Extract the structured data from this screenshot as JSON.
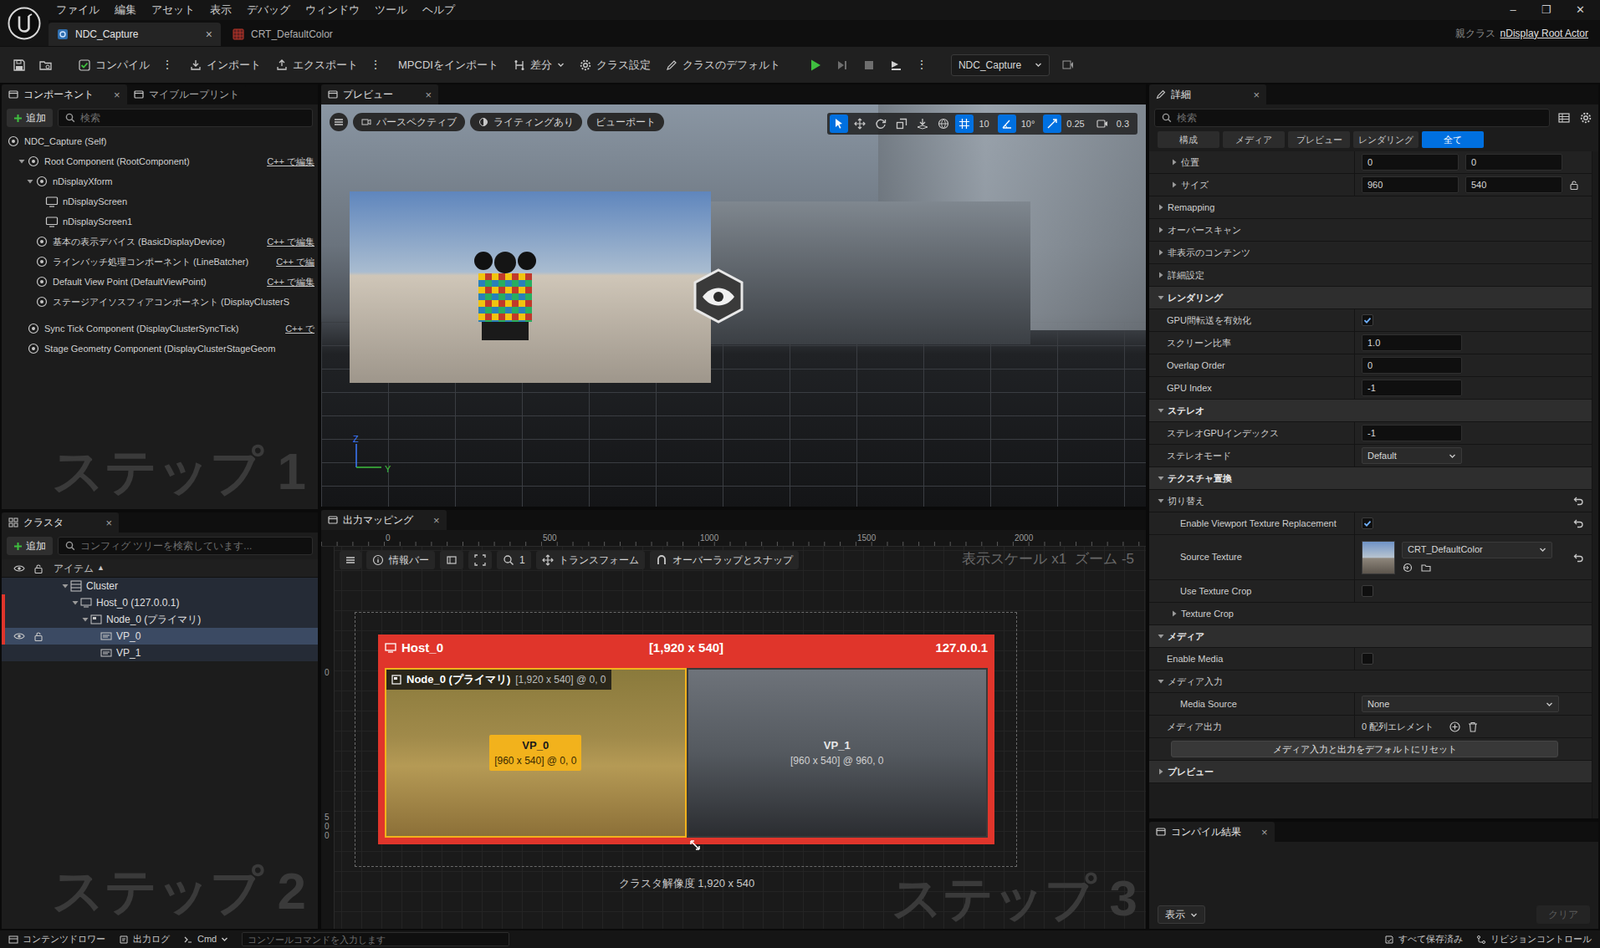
{
  "menu": {
    "items": [
      "ファイル",
      "編集",
      "アセット",
      "表示",
      "デバッグ",
      "ウィンドウ",
      "ツール",
      "ヘルプ"
    ],
    "window_controls": [
      "–",
      "❐",
      "✕"
    ]
  },
  "document_tabs": [
    {
      "label": "NDC_Capture",
      "selected": true,
      "close": "×"
    },
    {
      "label": "CRT_DefaultColor",
      "selected": false
    }
  ],
  "parent_class": {
    "label": "親クラス",
    "value": "nDisplay Root Actor"
  },
  "toolbar": {
    "items": [
      {
        "label": "コンパイル",
        "more": "⋮"
      },
      {
        "label": "インポート"
      },
      {
        "label": "エクスポート",
        "more": "⋮"
      },
      {
        "label": "MPCDIをインポート"
      },
      {
        "label": "差分",
        "dropdown": true
      },
      {
        "label": "クラス設定"
      },
      {
        "label": "クラスのデフォルト"
      }
    ],
    "play_more": "⋮",
    "debug_object": "NDC_Capture"
  },
  "components": {
    "tabs": [
      {
        "label": "コンポーネント",
        "selected": true,
        "close": "×"
      },
      {
        "label": "マイブループリント",
        "selected": false
      }
    ],
    "add": "追加",
    "search_placeholder": "検索",
    "tree": [
      {
        "label": "NDC_Capture (Self)",
        "depth": 0
      },
      {
        "label": "Root Component (RootComponent)",
        "depth": 1,
        "expanded": true,
        "edit": "C++ で編集"
      },
      {
        "label": "nDisplayXform",
        "depth": 2,
        "expanded": true
      },
      {
        "label": "nDisplayScreen",
        "depth": 3
      },
      {
        "label": "nDisplayScreen1",
        "depth": 3
      },
      {
        "label": "基本の表示デバイス (BasicDisplayDevice)",
        "depth": 2,
        "edit": "C++ で編集"
      },
      {
        "label": "ラインバッチ処理コンポーネント (LineBatcher)",
        "depth": 2,
        "edit": "C++ で編"
      },
      {
        "label": "Default View Point (DefaultViewPoint)",
        "depth": 2,
        "edit": "C++ で編集"
      },
      {
        "label": "ステージアイソスフィアコンポーネント (DisplayClusterS",
        "depth": 2
      },
      {
        "label": "Sync Tick Component (DisplayClusterSyncTick)",
        "depth": 1,
        "edit": "C++ で"
      },
      {
        "label": "Stage Geometry Component (DisplayClusterStageGeom",
        "depth": 1
      }
    ],
    "watermark": "ステップ 1"
  },
  "cluster": {
    "tab": "クラスタ",
    "close": "×",
    "add": "追加",
    "search_placeholder": "コンフィグ ツリーを検索しています...",
    "column": "アイテム",
    "sort": "▲",
    "tree": [
      {
        "label": "Cluster",
        "depth": 0,
        "expanded": true,
        "selected": false,
        "related": false
      },
      {
        "label": "Host_0 (127.0.0.1)",
        "depth": 1,
        "expanded": true,
        "selected": false,
        "related": true
      },
      {
        "label": "Node_0 (プライマリ)",
        "depth": 2,
        "expanded": true,
        "selected": false,
        "related": true
      },
      {
        "label": "VP_0",
        "depth": 3,
        "selected": true,
        "related": true
      },
      {
        "label": "VP_1",
        "depth": 3,
        "selected": false,
        "related": false
      }
    ],
    "watermark": "ステップ 2"
  },
  "preview": {
    "tab": "プレビュー",
    "close": "×",
    "buttons": [
      "パースペクティブ",
      "ライティングあり",
      "ビューポート"
    ],
    "tools": [
      {
        "kind": "select",
        "selected": true
      },
      {
        "kind": "move",
        "selected": false
      },
      {
        "kind": "rotate",
        "selected": false
      },
      {
        "kind": "scale",
        "selected": false
      },
      {
        "kind": "surface",
        "selected": false
      },
      {
        "kind": "coord",
        "selected": false
      },
      {
        "kind": "grid",
        "value": "10",
        "selected": true
      },
      {
        "kind": "angle",
        "value": "10°",
        "selected": true
      },
      {
        "kind": "scale-snap",
        "value": "0.25",
        "selected": true
      },
      {
        "kind": "camera-speed",
        "value": "0.3",
        "selected": false
      }
    ],
    "axis": [
      "Z",
      "Y"
    ]
  },
  "output_mapping": {
    "tab": "出力マッピング",
    "close": "×",
    "ruler_x": [
      "0",
      "500",
      "1000",
      "1500",
      "2000"
    ],
    "ruler_y": [
      "0",
      "500"
    ],
    "toolbar": {
      "info": "情報バー",
      "zoom": "1",
      "transform": "トランスフォーム",
      "snap": "オーバーラップとスナップ"
    },
    "view_scale": "表示スケール x1",
    "view_zoom": "ズーム -5",
    "host": {
      "name": "Host_0",
      "size": "[1,920 x 540]",
      "ip": "127.0.0.1",
      "node": {
        "name": "Node_0 (プライマリ)",
        "info": "[1,920 x 540] @ 0, 0"
      },
      "viewports": [
        {
          "name": "VP_0",
          "info": "[960 x 540] @ 0, 0",
          "selected": true
        },
        {
          "name": "VP_1",
          "info": "[960 x 540] @ 960, 0",
          "selected": false
        }
      ]
    },
    "resolution": "クラスタ解像度 1,920 x 540",
    "watermark": "ステップ 3"
  },
  "details": {
    "tab": "詳細",
    "close": "×",
    "search_placeholder": "検索",
    "filters": [
      {
        "label": "構成",
        "selected": false
      },
      {
        "label": "メディア",
        "selected": false
      },
      {
        "label": "プレビュー",
        "selected": false
      },
      {
        "label": "レンダリング",
        "selected": false
      },
      {
        "label": "全て",
        "selected": true
      }
    ],
    "rows": [
      {
        "kind": "vector",
        "label": "位置",
        "values": [
          "0",
          "0"
        ],
        "expanded": false,
        "indent": 1
      },
      {
        "kind": "vector",
        "label": "サイズ",
        "values": [
          "960",
          "540"
        ],
        "expanded": false,
        "indent": 1,
        "lock": true
      },
      {
        "kind": "group",
        "label": "Remapping",
        "expanded": false
      },
      {
        "kind": "group",
        "label": "オーバースキャン",
        "expanded": false
      },
      {
        "kind": "group",
        "label": "非表示のコンテンツ",
        "expanded": false
      },
      {
        "kind": "group",
        "label": "詳細設定",
        "expanded": false
      },
      {
        "kind": "section",
        "label": "レンダリング",
        "expanded": true
      },
      {
        "kind": "checkbox",
        "label": "GPU間転送を有効化",
        "checked": true
      },
      {
        "kind": "number",
        "label": "スクリーン比率",
        "value": "1.0"
      },
      {
        "kind": "number",
        "label": "Overlap Order",
        "value": "0"
      },
      {
        "kind": "number",
        "label": "GPU Index",
        "value": "-1"
      },
      {
        "kind": "section",
        "label": "ステレオ",
        "expanded": true
      },
      {
        "kind": "number",
        "label": "ステレオGPUインデックス",
        "value": "-1"
      },
      {
        "kind": "dropdown",
        "label": "ステレオモード",
        "value": "Default"
      },
      {
        "kind": "section",
        "label": "テクスチャ置換",
        "expanded": true
      },
      {
        "kind": "subsection",
        "label": "切り替え",
        "expanded": true,
        "reset": true
      },
      {
        "kind": "checkbox",
        "label": "Enable Viewport Texture Replacement",
        "checked": true,
        "indent": 1,
        "reset": true
      },
      {
        "kind": "texture",
        "label": "Source Texture",
        "value": "CRT_DefaultColor",
        "indent": 1,
        "reset": true
      },
      {
        "kind": "checkbox",
        "label": "Use Texture Crop",
        "checked": false,
        "indent": 1
      },
      {
        "kind": "group",
        "label": "Texture Crop",
        "expanded": false,
        "indent": 1
      },
      {
        "kind": "section",
        "label": "メディア",
        "expanded": true
      },
      {
        "kind": "checkbox",
        "label": "Enable Media",
        "checked": false
      },
      {
        "kind": "subsection",
        "label": "メディア入力",
        "expanded": true
      },
      {
        "kind": "dropdown",
        "label": "Media Source",
        "value": "None",
        "indent": 1,
        "wide": true
      },
      {
        "kind": "array",
        "label": "メディア出力",
        "value": "0 配列エレメント"
      },
      {
        "kind": "button",
        "label": "メディア入力と出力をデフォルトにリセット"
      },
      {
        "kind": "section",
        "label": "プレビュー",
        "expanded": false
      }
    ]
  },
  "compile_results": {
    "tab": "コンパイル結果",
    "close": "×",
    "show": "表示",
    "clear": "クリア",
    "clear_disabled": true
  },
  "status_bar": {
    "items": [
      {
        "label": "コンテンツドロワー"
      },
      {
        "label": "出力ログ"
      },
      {
        "label": "Cmd"
      }
    ],
    "console_placeholder": "コンソールコマンドを入力します",
    "right": [
      {
        "label": "すべて保存済み"
      },
      {
        "label": "リビジョンコントロール"
      }
    ]
  }
}
